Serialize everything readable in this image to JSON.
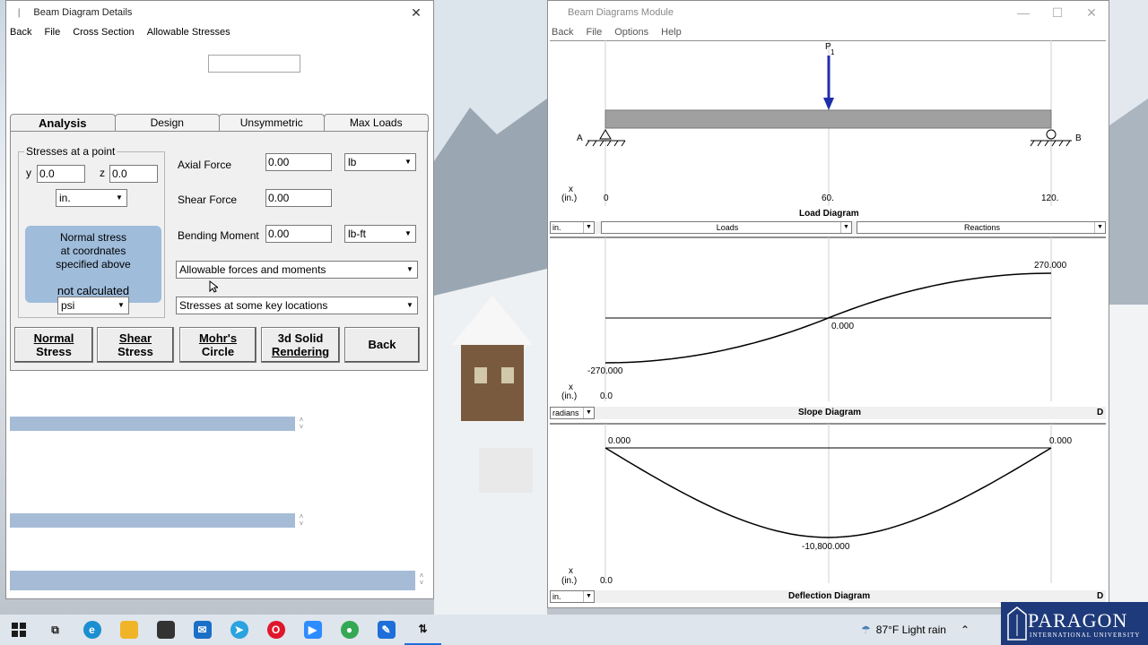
{
  "left_window": {
    "title": "Beam Diagram Details",
    "close": "✕",
    "menu": [
      "Back",
      "File",
      "Cross Section",
      "Allowable Stresses"
    ],
    "tabs": [
      "Analysis",
      "Design",
      "Unsymmetric",
      "Max Loads"
    ],
    "stresses_group": {
      "title": "Stresses at a point",
      "y_label": "y",
      "y_value": "0.0",
      "z_label": "z",
      "z_value": "0.0",
      "unit": "in.",
      "info_lines": [
        "Normal stress",
        "at coordnates",
        "specified above",
        "not calculated"
      ],
      "stress_unit": "psi"
    },
    "axial_force": {
      "label": "Axial Force",
      "value": "0.00",
      "unit": "lb"
    },
    "shear_force": {
      "label": "Shear Force",
      "value": "0.00"
    },
    "bending_moment": {
      "label": "Bending Moment",
      "value": "0.00",
      "unit": "lb-ft"
    },
    "dropdown1": "Allowable forces and moments",
    "dropdown2": "Stresses at some key locations",
    "buttons": [
      {
        "line1": "Normal",
        "line2": "Stress"
      },
      {
        "line1": "Shear",
        "line2": "Stress"
      },
      {
        "line1": "Mohr's",
        "line2": "Circle"
      },
      {
        "line1": "3d Solid",
        "line2": "Rendering"
      },
      {
        "line1": "Back",
        "line2": ""
      }
    ]
  },
  "right_window": {
    "title": "Beam Diagrams Module",
    "controls": [
      "—",
      "☐",
      "✕"
    ],
    "menu": [
      "Back",
      "File",
      "Options",
      "Help"
    ],
    "load_diagram": {
      "load_label": "P",
      "load_sub": "1",
      "support_a": "A",
      "support_b": "B",
      "x_label": "x",
      "x_unit": "(in.)",
      "ticks": [
        "0",
        "60.",
        "120."
      ],
      "caption": "Load Diagram",
      "unit_select": "in.",
      "loads_select": "Loads",
      "reactions_select": "Reactions"
    },
    "slope_diagram": {
      "max": "270.000",
      "min": "-270.000",
      "mid": "0.000",
      "x_label": "x",
      "x_unit": "(in.)",
      "x0": "0.0",
      "caption": "Slope Diagram",
      "unit_select": "radians",
      "corner": "D"
    },
    "deflection_diagram": {
      "left": "0.000",
      "right": "0.000",
      "min": "-10,800.000",
      "x_label": "x",
      "x_unit": "(in.)",
      "x0": "0.0",
      "caption": "Deflection Diagram",
      "unit_select": "in.",
      "corner": "D"
    }
  },
  "chart_data": [
    {
      "type": "line",
      "title": "Slope Diagram",
      "x": [
        0,
        30,
        60,
        90,
        120
      ],
      "values": [
        -270,
        -202.5,
        0,
        202.5,
        270
      ],
      "xlabel": "x (in.)",
      "ylabel": ""
    },
    {
      "type": "line",
      "title": "Deflection Diagram",
      "x": [
        0,
        30,
        60,
        90,
        120
      ],
      "values": [
        0,
        -7425,
        -10800,
        -7425,
        0
      ],
      "xlabel": "x (in.)",
      "ylabel": ""
    }
  ],
  "taskbar": {
    "weather": "87°F  Light rain",
    "logo_line1": "PARAGON",
    "logo_line2": "INTERNATIONAL UNIVERSITY"
  }
}
